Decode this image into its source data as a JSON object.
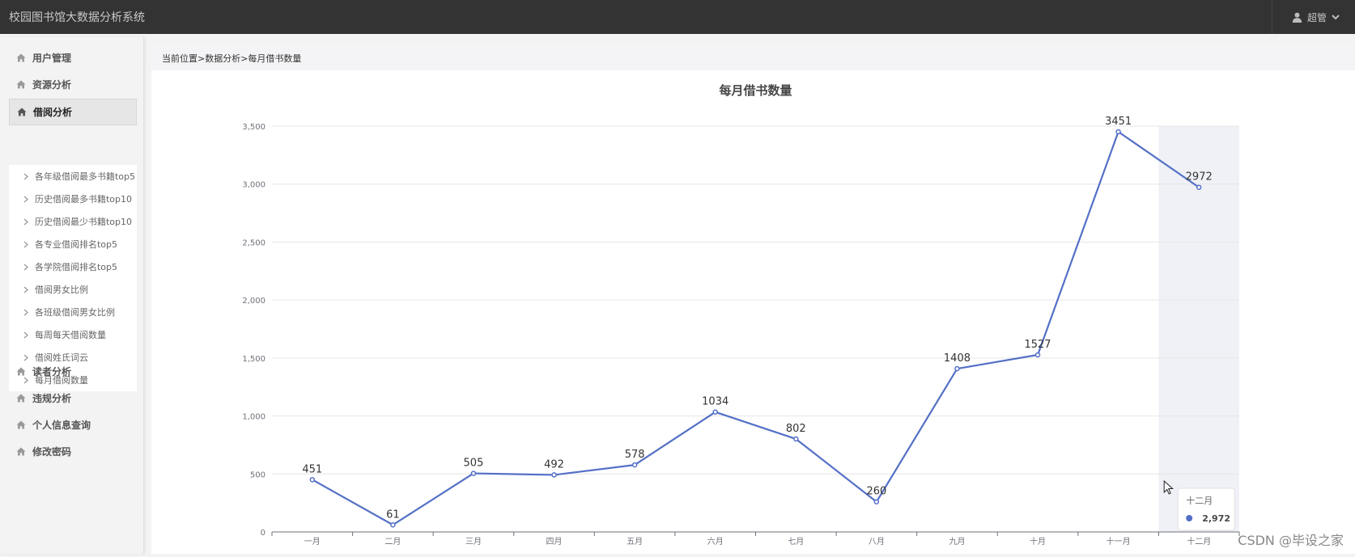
{
  "app": {
    "title": "校园图书馆大数据分析系统"
  },
  "user": {
    "name": "超管",
    "icon": "user-icon"
  },
  "sidebar": {
    "items": [
      {
        "label": "用户管理",
        "icon": "home-icon"
      },
      {
        "label": "资源分析",
        "icon": "home-icon"
      },
      {
        "label": "借阅分析",
        "icon": "home-icon",
        "active": true
      },
      {
        "label": "读者分析",
        "icon": "home-icon"
      },
      {
        "label": "违规分析",
        "icon": "home-icon"
      },
      {
        "label": "个人信息查询",
        "icon": "home-icon"
      },
      {
        "label": "修改密码",
        "icon": "home-icon"
      }
    ],
    "submenu": [
      "各年级借阅最多书籍top5",
      "历史借阅最多书籍top10",
      "历史借阅最少书籍top10",
      "各专业借阅排名top5",
      "各学院借阅排名top5",
      "借阅男女比例",
      "各班级借阅男女比例",
      "每周每天借阅数量",
      "借阅姓氏词云",
      "每月借阅数量"
    ]
  },
  "breadcrumb": "当前位置>数据分析>每月借书数量",
  "chart_data": {
    "type": "line",
    "title": "每月借书数量",
    "categories": [
      "一月",
      "二月",
      "三月",
      "四月",
      "五月",
      "六月",
      "七月",
      "八月",
      "九月",
      "十月",
      "十一月",
      "十二月"
    ],
    "values": [
      451,
      61,
      505,
      492,
      578,
      1034,
      802,
      260,
      1408,
      1527,
      3451,
      2972
    ],
    "ylim": [
      0,
      3500
    ],
    "yticks": [
      "0",
      "500",
      "1,000",
      "1,500",
      "2,000",
      "2,500",
      "3,000",
      "3,500"
    ],
    "color": "#5470c6",
    "grid": true,
    "highlight_index": 11,
    "tooltip": {
      "label": "十二月",
      "value": "2,972"
    }
  },
  "watermark": "CSDN @毕设之家"
}
